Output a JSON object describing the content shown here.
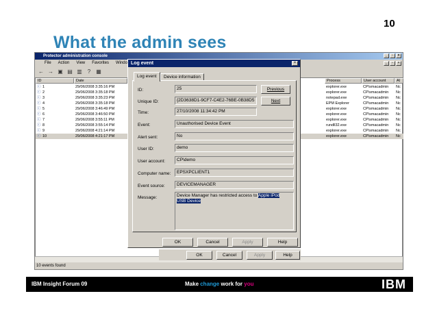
{
  "slide": {
    "number": "10",
    "title": "What the admin sees"
  },
  "console": {
    "title": "Protector administration console",
    "menu": [
      "File",
      "Action",
      "View",
      "Favorites",
      "Window"
    ],
    "columns": {
      "left": [
        "ID",
        "Date"
      ],
      "right": [
        "Process",
        "User account",
        "Al"
      ]
    },
    "rows": [
      {
        "id": "1",
        "date": "29/06/2008 3:35:16 PM",
        "process": "explorer.exe",
        "user": "CP\\smacadmin",
        "al": "Nc"
      },
      {
        "id": "2",
        "date": "29/06/2008 3:35:18 PM",
        "process": "explorer.exe",
        "user": "CP\\smacadmin",
        "al": "Nc"
      },
      {
        "id": "3",
        "date": "29/06/2008 3:35:23 PM",
        "process": "notepad.exe",
        "user": "CP\\smacadmin",
        "al": "Nc"
      },
      {
        "id": "4",
        "date": "29/06/2008 3:35:18 PM",
        "process": "EPM Explorer",
        "user": "CP\\smacadmin",
        "al": "Nc"
      },
      {
        "id": "5",
        "date": "29/06/2008 3:46:49 PM",
        "process": "explorer.exe",
        "user": "CP\\smacadmin",
        "al": "Nc"
      },
      {
        "id": "6",
        "date": "29/06/2008 3:46:50 PM",
        "process": "explorer.exe",
        "user": "CP\\smacadmin",
        "al": "Nc"
      },
      {
        "id": "7",
        "date": "29/06/2008 3:55:11 PM",
        "process": "explorer.exe",
        "user": "CP\\smacadmin",
        "al": "Nc"
      },
      {
        "id": "8",
        "date": "29/06/2008 3:55:14 PM",
        "process": "rundll32.exe",
        "user": "CP\\smacadmin",
        "al": "Nc"
      },
      {
        "id": "9",
        "date": "29/06/2008 4:21:14 PM",
        "process": "explorer.exe",
        "user": "CP\\smacadmin",
        "al": "Nc"
      },
      {
        "id": "10",
        "date": "29/06/2008 4:21:17 PM",
        "process": "explorer.exe",
        "user": "CP\\smacadmin",
        "al": "Nc"
      }
    ],
    "status": "10 events found"
  },
  "dialog": {
    "title": "Log event",
    "tabs": [
      "Log event",
      "Device information"
    ],
    "id_label": "ID:",
    "id": "25",
    "uid_label": "Unique ID:",
    "uid": "{2D3638D1-9CF7-C4E2-76BE-0B38D5",
    "time_label": "Time:",
    "time": "27/10/2008 11:34:42 PM",
    "event_label": "Event:",
    "event": "Unauthorised Device Event",
    "alert_label": "Alert sent:",
    "alert": "No",
    "userid_label": "User ID:",
    "userid": "demo",
    "account_label": "User account:",
    "account": "CP\\demo",
    "computer_label": "Computer name:",
    "computer": "EPSXPCLIENT1",
    "source_label": "Event source:",
    "source": "DEVICEMANAGER",
    "message_label": "Message:",
    "message_plain": "Device Manager has restricted access to ",
    "message_hl1": "Apple iPod",
    "message_hl2": "USB Device",
    "btn_previous": "Previous",
    "btn_next": "Next",
    "btn_ok": "OK",
    "btn_cancel": "Cancel",
    "btn_apply": "Apply",
    "btn_help": "Help"
  },
  "behind_buttons": {
    "ok": "OK",
    "cancel": "Cancel",
    "apply": "Apply",
    "help": "Help"
  },
  "footer": {
    "left": "IBM Insight Forum 09",
    "center_a": "Make ",
    "center_b": "change",
    "center_c": " work for ",
    "center_d": "you",
    "logo": "IBM"
  },
  "colors": {
    "title": "#2f84b6",
    "change": "#1f9ad6",
    "you": "#d8007e"
  }
}
